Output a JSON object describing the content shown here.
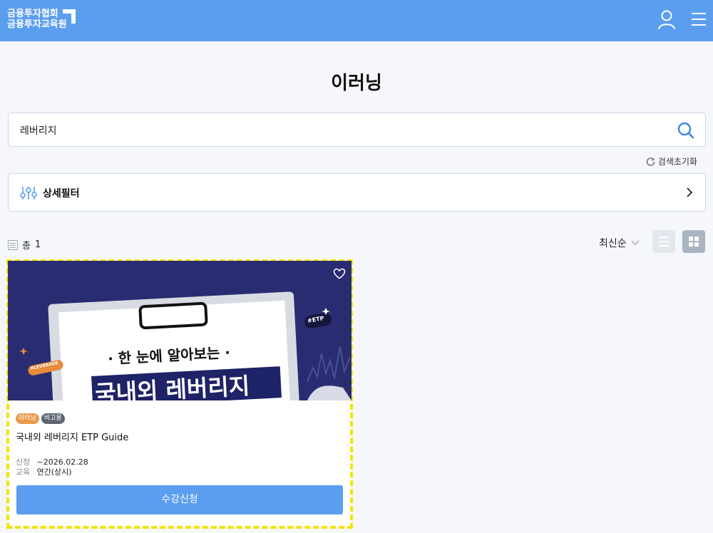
{
  "header": {
    "logo_line1": "금융투자협회",
    "logo_line2": "금융투자교육원"
  },
  "page": {
    "title": "이러닝"
  },
  "search": {
    "value": "레버리지",
    "reset_label": "검색초기화"
  },
  "filter": {
    "label": "상세필터"
  },
  "results": {
    "count_prefix": "총",
    "count": "1",
    "sort_label": "최신순"
  },
  "card": {
    "thumbnail": {
      "subtitle": "· 한 눈에 알아보는 ·",
      "headline": "국내외 레버리지",
      "badge_etp": "#ETP",
      "badge_leverage": "#LEVERAGE"
    },
    "tags": [
      "이러닝",
      "비고용"
    ],
    "title": "국내외 레버리지 ETP Guide",
    "apply_key": "신청",
    "apply_value": "~2026.02.28",
    "edu_key": "교육",
    "edu_value": "연간(상시)",
    "button_label": "수강신청"
  },
  "colors": {
    "brand": "#5b9ef0",
    "highlight": "#f5e400",
    "thumbnail_bg": "#2a2c72"
  }
}
